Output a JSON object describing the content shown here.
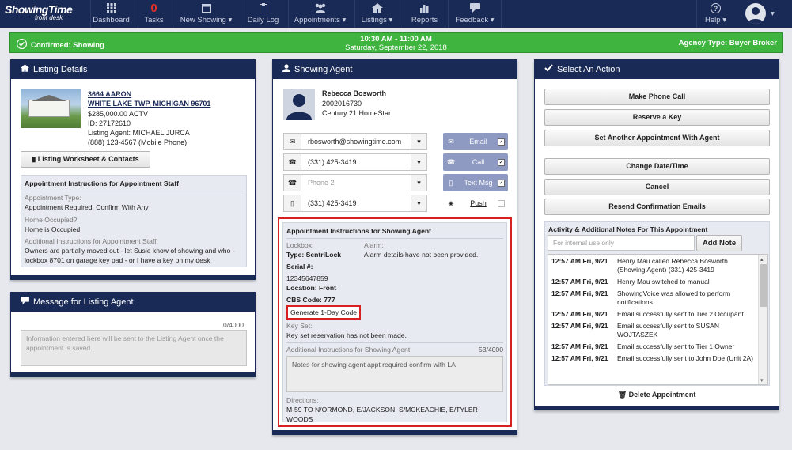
{
  "brand": {
    "logo_main": "ShowingTime",
    "logo_sub": "front desk"
  },
  "nav": {
    "dashboard": "Dashboard",
    "tasks_count": "0",
    "tasks": "Tasks",
    "new_showing": "New Showing",
    "daily_log": "Daily Log",
    "appointments": "Appointments",
    "listings": "Listings",
    "reports": "Reports",
    "feedback": "Feedback",
    "help": "Help"
  },
  "status": {
    "confirmed": "Confirmed: Showing",
    "time": "10:30 AM - 11:00 AM",
    "date": "Saturday, September 22, 2018",
    "agency": "Agency Type: Buyer Broker"
  },
  "listing": {
    "header": "Listing Details",
    "address1": "3664 AARON",
    "address2": "WHITE LAKE TWP, MICHIGAN 96701",
    "price": "$285,000.00 ACTV",
    "id": "ID: 27172610",
    "agent": "Listing Agent: MICHAEL JURCA",
    "phone": "(888) 123-4567 (Mobile Phone)",
    "worksheet_btn": "Listing Worksheet & Contacts",
    "instr_title": "Appointment Instructions for Appointment Staff",
    "appt_type_label": "Appointment Type:",
    "appt_type": "Appointment Required, Confirm With Any",
    "occupied_label": "Home Occupied?:",
    "occupied": "Home is Occupied",
    "add_instr_label": "Additional Instructions for Appointment Staff:",
    "add_instr": "Owners are partially moved out - let Susie know of showing and who - lockbox 8701 on garage key pad - or I have a key on my desk"
  },
  "message": {
    "header": "Message for Listing Agent",
    "count": "0/4000",
    "placeholder": "Information entered here will be sent to the Listing Agent once the appointment is saved."
  },
  "agent": {
    "header": "Showing Agent",
    "name": "Rebecca Bosworth",
    "number": "2002016730",
    "company": "Century 21 HomeStar",
    "email": "rbosworth@showingtime.com",
    "phone1": "(331) 425-3419",
    "phone_placeholder": "Phone 2",
    "phone3": "(331) 425-3419",
    "tool_email": "Email",
    "tool_call": "Call",
    "tool_text": "Text Msg",
    "tool_push": "Push",
    "instr_title": "Appointment Instructions for Showing Agent",
    "lockbox_label": "Lockbox:",
    "lockbox_type": "Type: SentriLock",
    "alarm_label": "Alarm:",
    "alarm": "Alarm details have not been provided.",
    "serial_label": "Serial #:",
    "serial": "12345647859",
    "location": "Location: Front",
    "cbs": "CBS Code: 777",
    "generate": "Generate 1-Day Code",
    "keyset_label": "Key Set:",
    "keyset": "Key set reservation has not been made.",
    "add_label": "Additional Instructions for Showing Agent:",
    "add_count": "53/4000",
    "add_text": "Notes for showing agent appt required confirm with LA",
    "directions_label": "Directions:",
    "directions": "M-59 TO N/ORMOND, E/JACKSON, S/MCKEACHIE, E/TYLER WOODS"
  },
  "actions": {
    "header": "Select An Action",
    "phone_call": "Make Phone Call",
    "reserve_key": "Reserve a Key",
    "another_appt": "Set Another Appointment With Agent",
    "change_date": "Change Date/Time",
    "cancel": "Cancel",
    "resend": "Resend Confirmation Emails",
    "notes_title": "Activity & Additional Notes For This Appointment",
    "notes_placeholder": "For internal use only",
    "add_note": "Add Note",
    "delete": "Delete Appointment",
    "notes": [
      {
        "ts": "12:57 AM Fri, 9/21",
        "text": "Henry Mau called Rebecca Bosworth (Showing Agent) (331) 425-3419"
      },
      {
        "ts": "12:57 AM Fri, 9/21",
        "text": "Henry Mau switched to manual"
      },
      {
        "ts": "12:57 AM Fri, 9/21",
        "text": "ShowingVoice was allowed to perform notifications"
      },
      {
        "ts": "12:57 AM Fri, 9/21",
        "text": "Email successfully sent to Tier 2 Occupant"
      },
      {
        "ts": "12:57 AM Fri, 9/21",
        "text": "Email successfully sent to SUSAN WOJTASZEK"
      },
      {
        "ts": "12:57 AM Fri, 9/21",
        "text": "Email successfully sent to Tier 1 Owner"
      },
      {
        "ts": "12:57 AM Fri, 9/21",
        "text": "Email successfully sent to John Doe (Unit 2A)"
      }
    ]
  },
  "colors": {
    "navy": "#1a2a56",
    "green": "#3fb53f",
    "red": "#d92020",
    "tool": "#8e9ac2"
  }
}
